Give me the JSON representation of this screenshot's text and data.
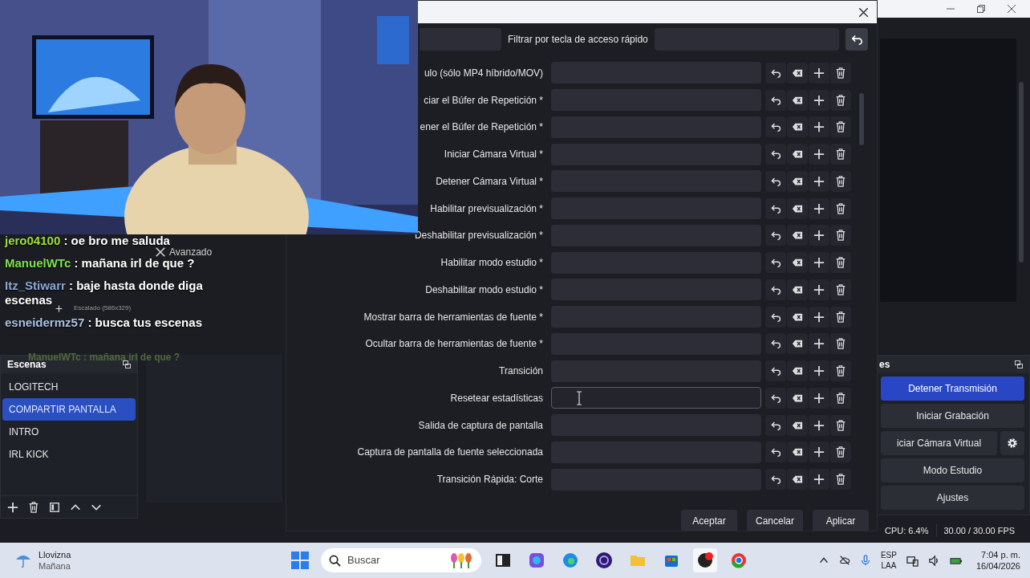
{
  "obs": {
    "scenes_title": "Escenas",
    "scenes": [
      {
        "label": "LOGITECH",
        "selected": false
      },
      {
        "label": "COMPARTIR PANTALLA",
        "selected": true
      },
      {
        "label": "INTRO",
        "selected": false
      },
      {
        "label": "IRL KICK",
        "selected": false
      }
    ],
    "advanced_label": "Avanzado",
    "scale_label": "Escalado (586x329)",
    "controls_title": "es",
    "controls": [
      {
        "label": "Detener Transmisión",
        "active": true,
        "gear": false
      },
      {
        "label": "Iniciar Grabación",
        "active": false,
        "gear": false
      },
      {
        "label": "iciar Cámara Virtual",
        "active": false,
        "gear": true
      },
      {
        "label": "Modo Estudio",
        "active": false,
        "gear": false
      },
      {
        "label": "Ajustes",
        "active": false,
        "gear": false
      }
    ],
    "status": [
      "CPU: 6.4%",
      "30.00 / 30.00 FPS"
    ]
  },
  "dialog": {
    "filter_label": "Filtrar por tecla de acceso rápido",
    "rows": [
      {
        "label": "ulo (sólo MP4 híbrido/MOV)",
        "focused": false
      },
      {
        "label": "ciar el Búfer de Repetición *",
        "focused": false
      },
      {
        "label": "ener el Búfer de Repetición *",
        "focused": false
      },
      {
        "label": "Iniciar Cámara Virtual *",
        "focused": false
      },
      {
        "label": "Detener Cámara Virtual *",
        "focused": false
      },
      {
        "label": "Habilitar previsualización *",
        "focused": false
      },
      {
        "label": "Deshabilitar previsualización *",
        "focused": false
      },
      {
        "label": "Habilitar modo estudio *",
        "focused": false
      },
      {
        "label": "Deshabilitar modo estudio *",
        "focused": false
      },
      {
        "label": "Mostrar barra de herramientas de fuente *",
        "focused": false
      },
      {
        "label": "Ocultar barra de herramientas de fuente *",
        "focused": false
      },
      {
        "label": "Transición",
        "focused": false
      },
      {
        "label": "Resetear estadísticas",
        "focused": true
      },
      {
        "label": "Salida de captura de pantalla",
        "focused": false
      },
      {
        "label": "Captura de pantalla de fuente seleccionada",
        "focused": false
      },
      {
        "label": "Transición Rápida: Corte",
        "focused": false
      }
    ],
    "buttons": [
      "Aceptar",
      "Cancelar",
      "Aplicar"
    ]
  },
  "chat": [
    {
      "user": "jero04100",
      "color": "#9be03c",
      "message": ": oe bro me saluda"
    },
    {
      "user": "ManuelWTc",
      "color": "#7ee04a",
      "message": ": mañana irl de que ?"
    },
    {
      "user": "Itz_Stiwarr",
      "color": "#8aa8d8",
      "message": ": baje hasta donde diga escenas"
    },
    {
      "user": "esneidermz57",
      "color": "#a9c1e0",
      "message": ": busca tus escenas"
    }
  ],
  "chat_ghost": "ManuelWTc : mañana irl de que ?",
  "taskbar": {
    "weather": [
      "Llovizna",
      "Mañana"
    ],
    "search_placeholder": "Buscar",
    "language": [
      "ESP",
      "LAA"
    ],
    "time": "7:04 p. m.",
    "date": "16/04/2026"
  }
}
